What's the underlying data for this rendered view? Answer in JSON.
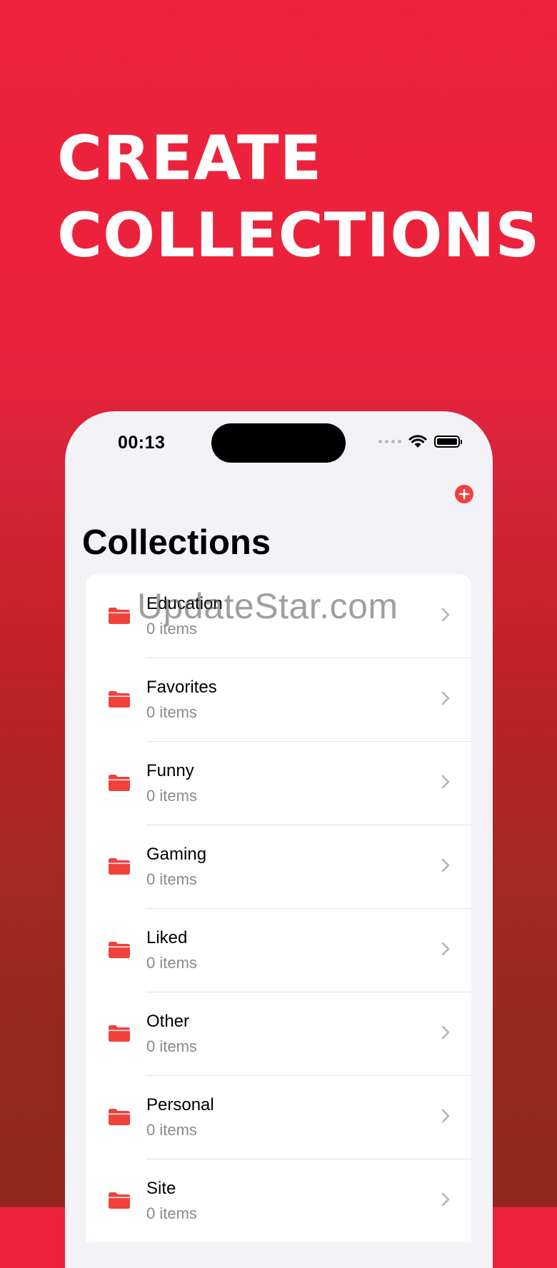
{
  "promo": {
    "line1": "CREATE",
    "line2": "COLLECTIONS"
  },
  "status_bar": {
    "time": "00:13"
  },
  "screen": {
    "title": "Collections"
  },
  "collections": [
    {
      "name": "Education",
      "count": "0 items"
    },
    {
      "name": "Favorites",
      "count": "0 items"
    },
    {
      "name": "Funny",
      "count": "0 items"
    },
    {
      "name": "Gaming",
      "count": "0 items"
    },
    {
      "name": "Liked",
      "count": "0 items"
    },
    {
      "name": "Other",
      "count": "0 items"
    },
    {
      "name": "Personal",
      "count": "0 items"
    },
    {
      "name": "Site",
      "count": "0 items"
    }
  ],
  "watermark": "UpdateStar.com",
  "colors": {
    "accent": "#F0413B",
    "background_top": "#ED233D",
    "background_bottom": "#93271F"
  },
  "icons": {
    "add": "plus-circle-icon",
    "folder": "folder-icon",
    "chevron": "chevron-right-icon"
  }
}
